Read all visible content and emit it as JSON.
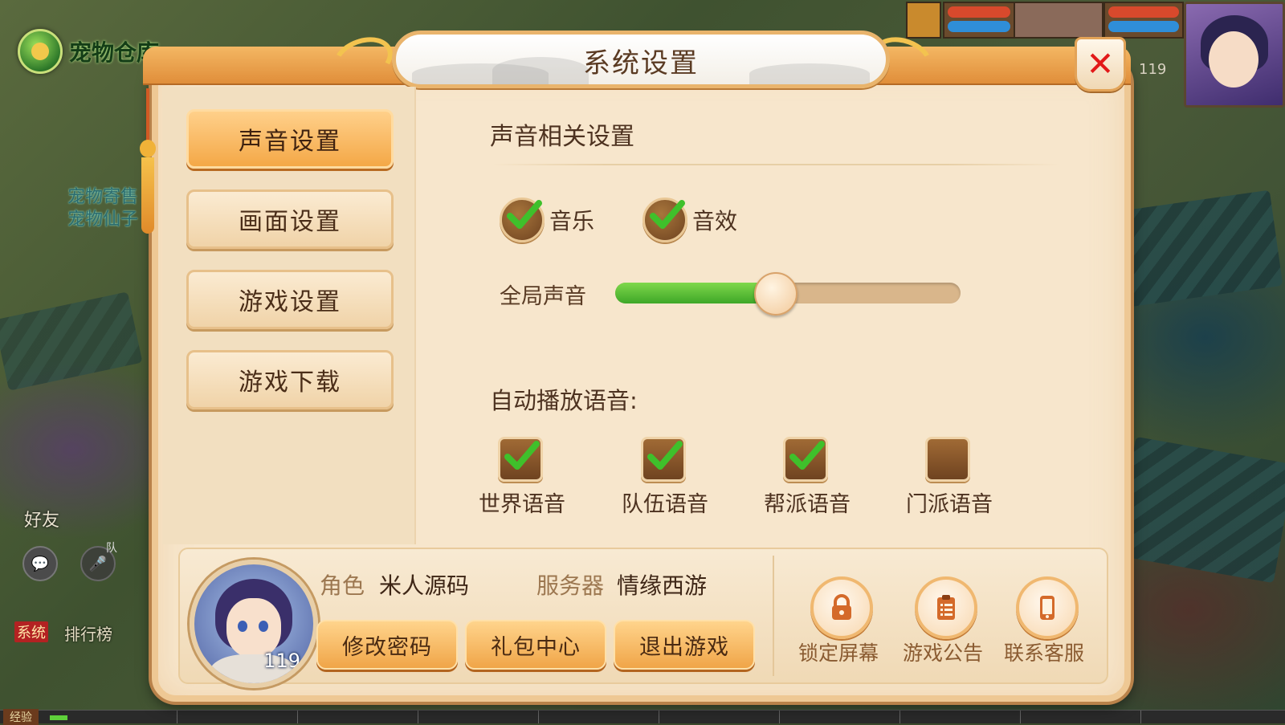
{
  "background": {
    "pet_entry_label": "宠物仓库",
    "npc_lines": [
      "宠物寄售",
      "宠物仙子"
    ],
    "friends_label": "好友",
    "team_label": "队",
    "system_tag": "系统",
    "rank_label": "排行榜",
    "player_level_top": "119",
    "exp_label": "经验"
  },
  "dialog": {
    "title": "系统设置",
    "close_icon": "close-x-icon"
  },
  "tabs": [
    {
      "label": "声音设置",
      "active": true
    },
    {
      "label": "画面设置",
      "active": false
    },
    {
      "label": "游戏设置",
      "active": false
    },
    {
      "label": "游戏下载",
      "active": false
    }
  ],
  "sound": {
    "section_title": "声音相关设置",
    "toggles": [
      {
        "label": "音乐",
        "checked": true
      },
      {
        "label": "音效",
        "checked": true
      }
    ],
    "volume_label": "全局声音",
    "volume_fraction": 0.46,
    "auto_play_title": "自动播放语音:",
    "voice_channels": [
      {
        "label": "世界语音",
        "checked": true
      },
      {
        "label": "队伍语音",
        "checked": true
      },
      {
        "label": "帮派语音",
        "checked": true
      },
      {
        "label": "门派语音",
        "checked": false
      }
    ]
  },
  "player": {
    "role_key": "角色",
    "role_value": "米人源码",
    "server_key": "服务器",
    "server_value": "情缘西游",
    "level": "119"
  },
  "actions": [
    {
      "label": "修改密码"
    },
    {
      "label": "礼包中心"
    },
    {
      "label": "退出游戏"
    }
  ],
  "shortcuts": [
    {
      "label": "锁定屏幕",
      "icon": "lock-icon"
    },
    {
      "label": "游戏公告",
      "icon": "clipboard-icon"
    },
    {
      "label": "联系客服",
      "icon": "phone-icon"
    }
  ],
  "colors": {
    "accent_orange": "#f4a847",
    "check_green": "#3fc02b",
    "close_red": "#e21919",
    "slider_green": "#3ea728"
  }
}
